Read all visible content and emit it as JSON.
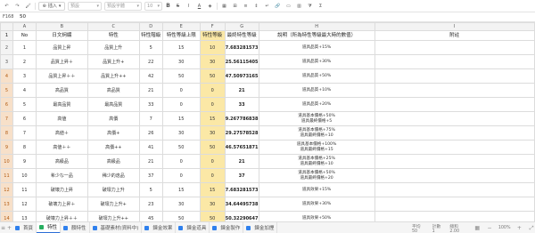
{
  "toolbar": {
    "insert_label": "插入",
    "font_placeholder": "預設",
    "format_placeholder": "預設字體",
    "size_placeholder": "10"
  },
  "formula_bar": {
    "cell_ref": "F168",
    "value": "50"
  },
  "columns": [
    "",
    "A",
    "B",
    "C",
    "D",
    "E",
    "F",
    "G",
    "H",
    "I"
  ],
  "header_labels": {
    "no": "No",
    "name": "日文詞綴",
    "trait": "特性",
    "level": "特性階級",
    "max_level": "特性等級上限",
    "grade": "特性等級",
    "effect_grade": "最終特性等級",
    "desc": "說明（所為特性等級最大時的數值）",
    "note": "附註"
  },
  "rows": [
    {
      "rn": "2",
      "no": "1",
      "name": "品質上昇",
      "trait": "品質上升",
      "level": "5",
      "max_level": "15",
      "grade": "10",
      "effect_grade": "7.683281573",
      "desc": "道具品質+15%"
    },
    {
      "rn": "3",
      "no": "2",
      "name": "品質上昇＋",
      "trait": "品質上升+",
      "level": "22",
      "max_level": "30",
      "grade": "30",
      "effect_grade": "25.56115405",
      "desc": "道具品質+30%"
    },
    {
      "rn": "4",
      "no": "3",
      "name": "品質上昇＋＋",
      "trait": "品質上升++",
      "level": "42",
      "max_level": "50",
      "grade": "50",
      "effect_grade": "47.50973165",
      "desc": "道具品質+50%"
    },
    {
      "rn": "5",
      "no": "4",
      "name": "高品質",
      "trait": "高品質",
      "level": "21",
      "max_level": "0",
      "grade": "0",
      "effect_grade": "21",
      "desc": "道具品質+10%"
    },
    {
      "rn": "6",
      "no": "5",
      "name": "最高品質",
      "trait": "最高品質",
      "level": "33",
      "max_level": "0",
      "grade": "0",
      "effect_grade": "33",
      "desc": "道具品質+20%"
    },
    {
      "rn": "7",
      "no": "6",
      "name": "高値",
      "trait": "高價",
      "level": "7",
      "max_level": "15",
      "grade": "15",
      "effect_grade": "9.267786838",
      "desc": "道具基本價格+50%\n道具最終價格+5"
    },
    {
      "rn": "8",
      "no": "7",
      "name": "高値＋",
      "trait": "高價+",
      "level": "26",
      "max_level": "30",
      "grade": "30",
      "effect_grade": "29.27578528",
      "desc": "道具基本價格+75%\n道具最終價格+10"
    },
    {
      "rn": "9",
      "no": "8",
      "name": "高値＋＋",
      "trait": "高價++",
      "level": "41",
      "max_level": "50",
      "grade": "50",
      "effect_grade": "46.57651871",
      "desc": "道具基本價格+100%\n道具最終價格+15"
    },
    {
      "rn": "10",
      "no": "9",
      "name": "高級品",
      "trait": "高級品",
      "level": "21",
      "max_level": "0",
      "grade": "0",
      "effect_grade": "21",
      "desc": "道具基本價格+25%\n道具最終價格+10"
    },
    {
      "rn": "11",
      "no": "10",
      "name": "希少な一品",
      "trait": "稀少的逸品",
      "level": "37",
      "max_level": "0",
      "grade": "0",
      "effect_grade": "37",
      "desc": "道具基本價格+50%\n道具最終價格+20"
    },
    {
      "rn": "12",
      "no": "11",
      "name": "破壊力上昇",
      "trait": "破壞力上升",
      "level": "5",
      "max_level": "15",
      "grade": "15",
      "effect_grade": "7.683281573",
      "desc": "道具效果+15%"
    },
    {
      "rn": "13",
      "no": "12",
      "name": "破壊力上昇＋",
      "trait": "破壞力上升+",
      "level": "23",
      "max_level": "30",
      "grade": "30",
      "effect_grade": "34.64495738",
      "desc": "道具效果+30%"
    },
    {
      "rn": "14",
      "no": "13",
      "name": "破壊力上昇＋＋",
      "trait": "破壞力上升++",
      "level": "45",
      "max_level": "50",
      "grade": "50",
      "effect_grade": "50.32290647",
      "desc": "道具效果+50%"
    },
    {
      "rn": "15",
      "no": "14",
      "name": "大きな破壊力",
      "trait": "強大的破壞力",
      "level": "15",
      "max_level": "0",
      "grade": "0",
      "effect_grade": "15",
      "desc": "道具效果+10%"
    }
  ],
  "sheet_tabs": [
    {
      "label": "首頁",
      "color": "#2f80ed"
    },
    {
      "label": "特性",
      "color": "#27ae60"
    },
    {
      "label": "顏特性",
      "color": "#2f80ed"
    },
    {
      "label": "基礎素材(資料中)",
      "color": "#2f80ed"
    },
    {
      "label": "鍊金效果",
      "color": "#2f80ed"
    },
    {
      "label": "鍊金道具",
      "color": "#2f80ed"
    },
    {
      "label": "鍊金製作",
      "color": "#2f80ed"
    },
    {
      "label": "鍊金加煙",
      "color": "#2f80ed"
    }
  ],
  "status": {
    "avg": "平均 50",
    "count": "計數 1",
    "sum": "總和 2.00",
    "zoom": "100%"
  }
}
